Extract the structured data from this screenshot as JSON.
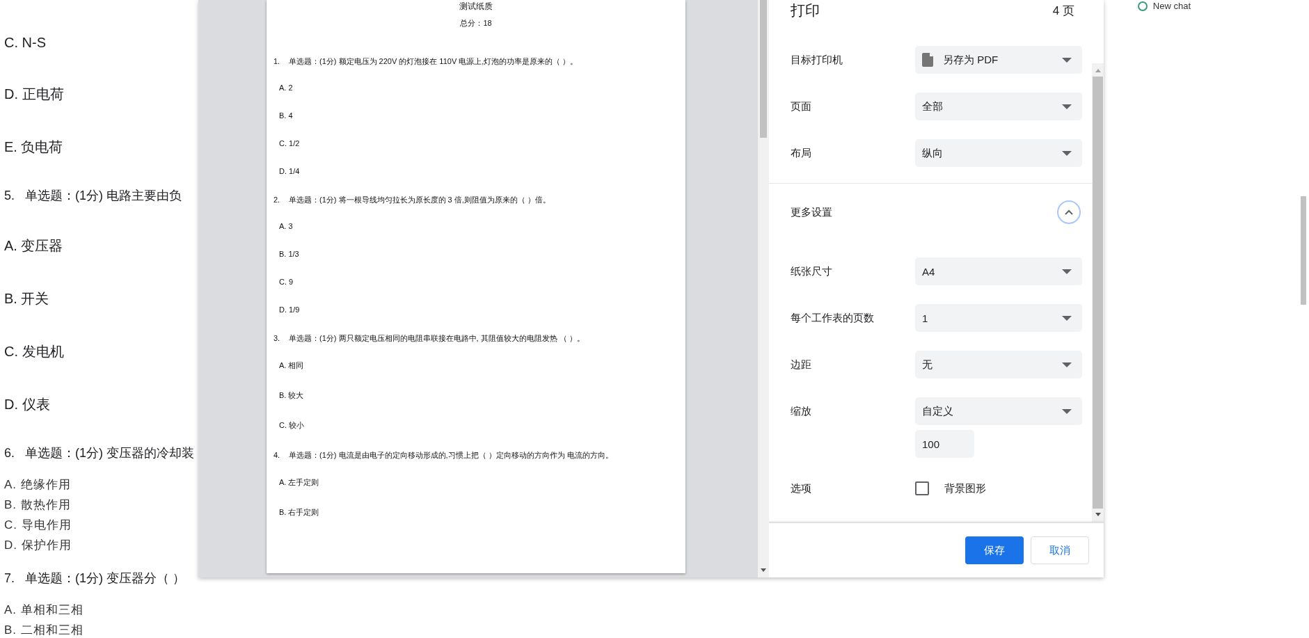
{
  "bookmarks": [
    {
      "label": "New chat"
    }
  ],
  "document": {
    "items": [
      {
        "kind": "option",
        "text": "C. N-S"
      },
      {
        "kind": "option",
        "text": "D. 正电荷"
      },
      {
        "kind": "option",
        "text": "E. 负电荷"
      },
      {
        "kind": "question",
        "number": "5.",
        "text": "单选题：(1分) 电路主要由负"
      },
      {
        "kind": "option",
        "text": "A. 变压器"
      },
      {
        "kind": "option",
        "text": "B. 开关"
      },
      {
        "kind": "option",
        "text": "C. 发电机"
      },
      {
        "kind": "option",
        "text": "D. 仪表"
      },
      {
        "kind": "question",
        "number": "6.",
        "text": "单选题：(1分) 变压器的冷却装"
      },
      {
        "kind": "compact",
        "text": "A. 绝缘作用"
      },
      {
        "kind": "compact",
        "text": "B. 散热作用"
      },
      {
        "kind": "compact",
        "text": "C. 导电作用"
      },
      {
        "kind": "compact",
        "text": "D. 保护作用"
      },
      {
        "kind": "question",
        "number": "7.",
        "text": "单选题：(1分) 变压器分（ ）"
      },
      {
        "kind": "compact",
        "text": "A. 单相和三相"
      },
      {
        "kind": "compact",
        "text": "B. 二相和三相"
      }
    ]
  },
  "preview": {
    "title": "测试纸质",
    "total": "总分：18",
    "questions": [
      {
        "number": "1.",
        "text": "单选题：(1分) 额定电压为 220V 的灯泡接在 110V 电源上,灯泡的功率是原来的（ ）。",
        "options": [
          "A. 2",
          "B. 4",
          "C. 1/2",
          "D. 1/4"
        ]
      },
      {
        "number": "2.",
        "text": "单选题：(1分) 将一根导线均匀拉长为原长度的 3 倍,则阻值为原来的（ ）倍。",
        "options": [
          "A. 3",
          "B. 1/3",
          "C. 9",
          "D. 1/9"
        ]
      },
      {
        "number": "3.",
        "text": "单选题：(1分) 两只额定电压相同的电阻串联接在电路中, 其阻值较大的电阻发热 （ ）。",
        "options": [
          "A. 相同",
          "B. 较大",
          "C. 较小"
        ]
      },
      {
        "number": "4.",
        "text": "单选题：(1分) 电流是由电子的定向移动形成的,习惯上把（ ）定向移动的方向作为 电流的方向。",
        "options": [
          "A. 左手定则",
          "B. 右手定则"
        ]
      }
    ]
  },
  "print_panel": {
    "title": "打印",
    "page_count": "4 页",
    "settings": [
      {
        "kind": "destination",
        "label": "目标打印机",
        "value": "另存为 PDF"
      },
      {
        "kind": "select",
        "label": "页面",
        "value": "全部"
      },
      {
        "kind": "select",
        "label": "布局",
        "value": "纵向"
      },
      {
        "kind": "divider"
      },
      {
        "kind": "expander",
        "label": "更多设置",
        "expanded": true
      },
      {
        "kind": "select",
        "label": "纸张尺寸",
        "value": "A4"
      },
      {
        "kind": "select",
        "label": "每个工作表的页数",
        "value": "1"
      },
      {
        "kind": "select",
        "label": "边距",
        "value": "无"
      },
      {
        "kind": "select",
        "label": "缩放",
        "value": "自定义"
      },
      {
        "kind": "input",
        "value": "100"
      },
      {
        "kind": "checkbox",
        "label": "选项",
        "option": "背景图形",
        "checked": false
      }
    ],
    "buttons": [
      {
        "label": "保存",
        "kind": "primary"
      },
      {
        "label": "取消",
        "kind": "secondary"
      }
    ]
  }
}
